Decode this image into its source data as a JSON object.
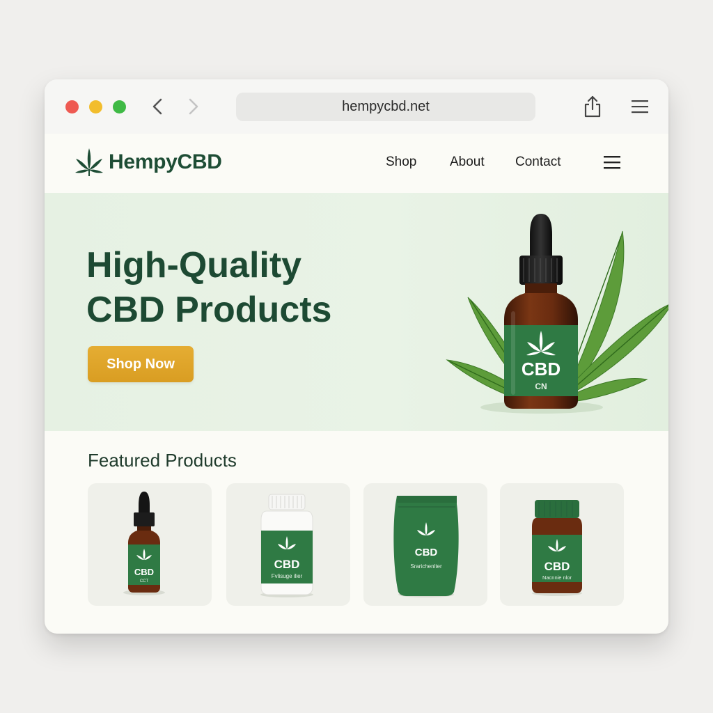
{
  "browser": {
    "url": "hempycbd.net"
  },
  "site": {
    "brand": "HempyCBD",
    "nav": {
      "shop": "Shop",
      "about": "About",
      "contact": "Contact"
    }
  },
  "hero": {
    "title_line1": "High-Quality",
    "title_line2": "CBD Products",
    "cta": "Shop Now",
    "bottle_label": "CBD",
    "bottle_sublabel": "CN"
  },
  "featured": {
    "title": "Featured Products",
    "products": [
      {
        "label": "CBD",
        "sublabel": "CCT"
      },
      {
        "label": "CBD",
        "sublabel": "Fvlisuge ilier"
      },
      {
        "label": "CBD",
        "sublabel": "Srarichenlter"
      },
      {
        "label": "CBD",
        "sublabel": "Nacnnie nlor"
      }
    ]
  },
  "colors": {
    "brand_green": "#1e4d35",
    "label_green": "#2f7a44",
    "cta_gold": "#e0a52c",
    "hero_bg": "#e7f2e4",
    "amber_glass": "#6b2e12"
  },
  "icons": {
    "logo": "hemp-leaf-icon",
    "back": "chevron-left-icon",
    "forward": "chevron-right-icon",
    "share": "share-icon",
    "menu": "hamburger-menu-icon"
  }
}
